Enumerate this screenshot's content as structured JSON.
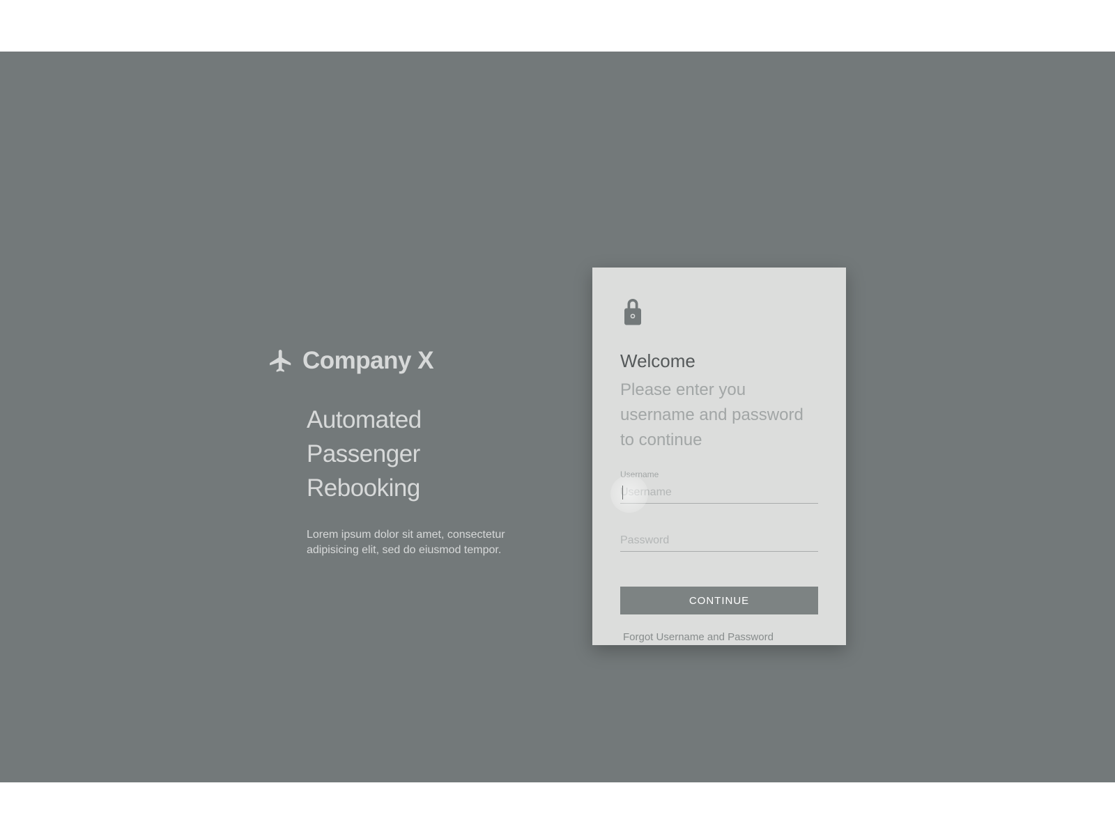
{
  "brand": {
    "name": "Company X",
    "headline": "Automated Passenger Rebooking",
    "description": "Lorem ipsum dolor sit amet, consectetur adipisicing elit, sed do eiusmod tempor."
  },
  "login": {
    "welcome_title": "Welcome",
    "welcome_sub": "Please enter you username and password to continue",
    "username": {
      "float_label": "Username",
      "placeholder": "Username",
      "value": ""
    },
    "password": {
      "placeholder": "Password",
      "value": ""
    },
    "continue_label": "CONTINUE",
    "forgot_label": "Forgot Username and Password"
  },
  "colors": {
    "page_bg": "#73797a",
    "card_bg": "#dcdddc",
    "brand_text": "#d7d9d9",
    "muted_text": "#a2a6a6",
    "dark_text": "#55595a",
    "button_bg": "#7d8383"
  }
}
